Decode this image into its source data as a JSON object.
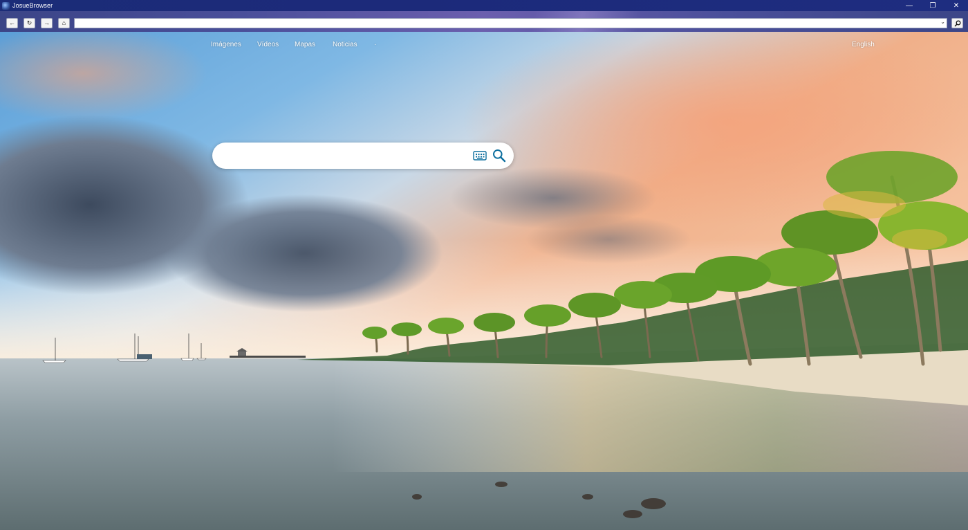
{
  "window": {
    "title": "JosueBrowser",
    "minimize_glyph": "—",
    "restore_glyph": "❐",
    "close_glyph": "✕"
  },
  "toolbar": {
    "back_glyph": "←",
    "refresh_glyph": "↻",
    "forward_glyph": "→",
    "home_glyph": "⌂",
    "url_value": "",
    "url_dropdown_glyph": "⌄"
  },
  "nav": {
    "images": "Imágenes",
    "videos": "Vídeos",
    "maps": "Mapas",
    "news": "Noticias",
    "more": "·",
    "language": "English"
  },
  "search": {
    "placeholder": "",
    "value": ""
  },
  "icons": {
    "app": "browser-app-icon",
    "keyboard": "keyboard-icon",
    "search": "search-icon",
    "go": "magnifier-icon"
  },
  "colors": {
    "titlebar": "#1c2a7a",
    "search_icon": "#0c6e9e"
  }
}
